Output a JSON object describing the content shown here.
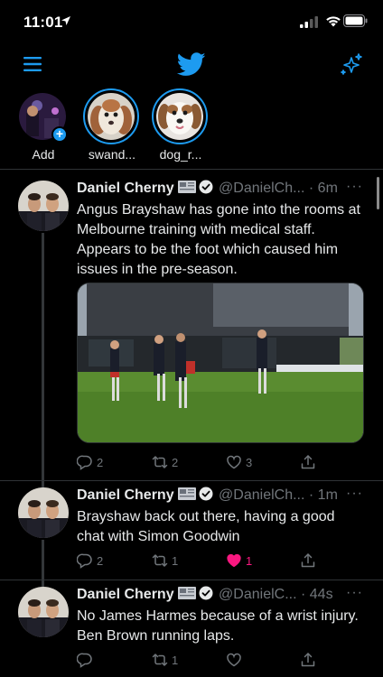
{
  "status_bar": {
    "time": "11:01"
  },
  "fleets": [
    {
      "name": "Add"
    },
    {
      "name": "swand..."
    },
    {
      "name": "dog_r..."
    }
  ],
  "tweets": [
    {
      "display_name": "Daniel Cherny",
      "handle": "@DanielCh...",
      "time": "· 6m",
      "text": "Angus Brayshaw has gone into the rooms at Melbourne training with medical staff. Appears to be the foot which caused him issues in the pre-season.",
      "replies": "2",
      "retweets": "2",
      "likes": "3"
    },
    {
      "display_name": "Daniel Cherny",
      "handle": "@DanielCh...",
      "time": "· 1m",
      "text": "Brayshaw back out there, having a good chat with Simon Goodwin",
      "replies": "2",
      "retweets": "1",
      "likes": "1"
    },
    {
      "display_name": "Daniel Cherny",
      "handle": "@DanielC...",
      "time": "· 44s",
      "text": "No James Harmes because of a wrist injury. Ben Brown running laps.",
      "replies": "",
      "retweets": "1",
      "likes": ""
    }
  ],
  "colors": {
    "accent": "#1d9bf0",
    "like": "#f91880",
    "muted": "#71767b"
  }
}
